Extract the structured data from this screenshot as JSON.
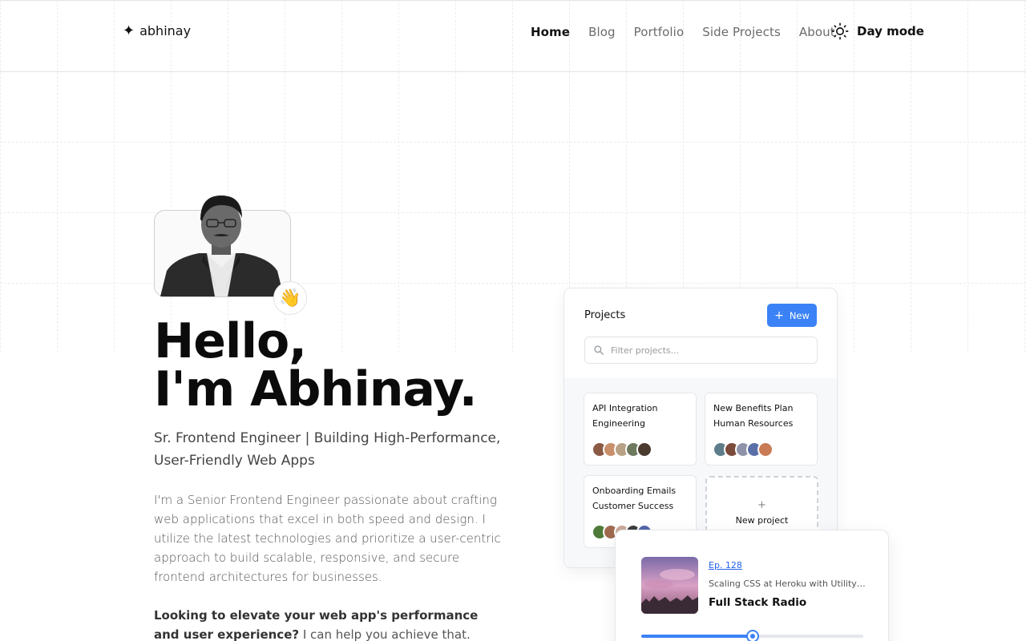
{
  "header": {
    "logo_icon": "sparkle-icon",
    "logo_text": "abhinay",
    "nav": [
      {
        "label": "Home",
        "active": true
      },
      {
        "label": "Blog",
        "active": false
      },
      {
        "label": "Portfolio",
        "active": false
      },
      {
        "label": "Side Projects",
        "active": false
      },
      {
        "label": "About",
        "active": false
      }
    ],
    "theme_icon": "sun-icon",
    "theme_label": "Day mode"
  },
  "hero": {
    "wave_emoji": "👋",
    "greeting_line1": "Hello,",
    "greeting_line2": "I'm Abhinay.",
    "subtitle": "Sr. Frontend Engineer | Building High-Performance, User-Friendly Web Apps",
    "intro": "I'm a Senior Frontend Engineer passionate about crafting web applications that excel in both speed and design. I utilize the latest technologies and prioritize a user-centric approach to build scalable, responsive, and secure frontend architectures for businesses.",
    "cta_bold": "Looking to elevate your web app's performance and user experience?",
    "cta_rest": " I can help you achieve that."
  },
  "projects_panel": {
    "title": "Projects",
    "new_button": "New",
    "filter_placeholder": "Filter projects...",
    "projects": [
      {
        "name": "API Integration",
        "team": "Engineering"
      },
      {
        "name": "New Benefits Plan",
        "team": "Human Resources"
      },
      {
        "name": "Onboarding Emails",
        "team": "Customer Success"
      }
    ],
    "new_project_label": "New project"
  },
  "podcast": {
    "episode": "Ep. 128",
    "episode_title": "Scaling CSS at Heroku with Utility Classes",
    "show": "Full Stack Radio",
    "progress": 0.5
  },
  "colors": {
    "accent": "#3b82f6",
    "text": "#111111",
    "muted": "#6b6b6b"
  }
}
